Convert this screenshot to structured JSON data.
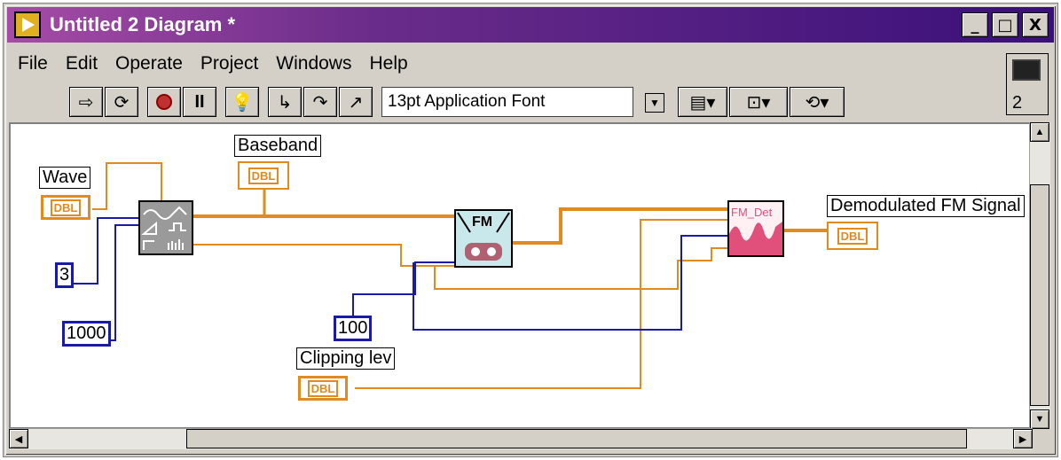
{
  "window": {
    "title": "Untitled 2 Diagram *",
    "buttons": {
      "minimize": "_",
      "maximize": "□",
      "close": "X"
    }
  },
  "menu": [
    "File",
    "Edit",
    "Operate",
    "Project",
    "Windows",
    "Help"
  ],
  "toolbar": {
    "font": "13pt Application Font"
  },
  "context_help": {
    "number": "2"
  },
  "diagram": {
    "wave_label": "Wave",
    "wave_terminal": "DBL",
    "baseband_label": "Baseband",
    "baseband_terminal": "DBL",
    "const_3": "3",
    "const_1000": "1000",
    "const_100": "100",
    "clipping_label": "Clipping lev",
    "clipping_terminal": "DBL",
    "fm_node": "FM",
    "fm_det_node": "FM_Det",
    "demod_label": "Demodulated FM Signal",
    "demod_terminal": "DBL"
  },
  "colors": {
    "wire_dbl": "#e08a20",
    "wire_int": "#1a1aa8",
    "title_start": "#a64ca6",
    "title_end": "#3a107a"
  }
}
